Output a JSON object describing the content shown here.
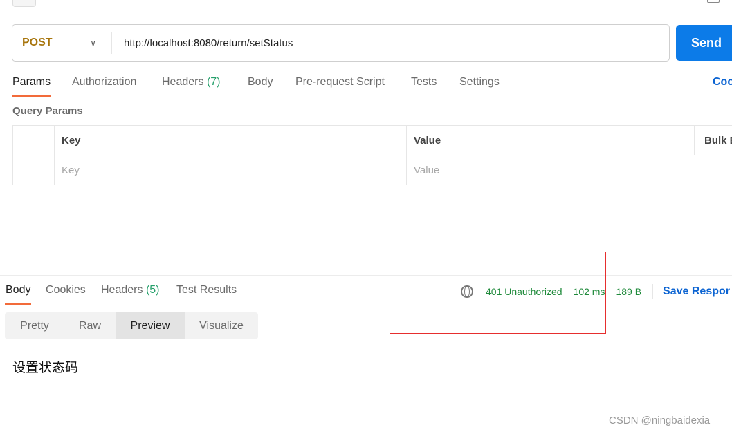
{
  "request": {
    "method": "POST",
    "url": "http://localhost:8080/return/setStatus",
    "send_label": "Send"
  },
  "tabs": [
    {
      "label": "Params"
    },
    {
      "label": "Authorization"
    },
    {
      "label": "Headers",
      "count": "(7)"
    },
    {
      "label": "Body"
    },
    {
      "label": "Pre-request Script"
    },
    {
      "label": "Tests"
    },
    {
      "label": "Settings"
    }
  ],
  "code_label": "Coo",
  "query_params": {
    "title": "Query Params",
    "headers": [
      "Key",
      "Value",
      "Bulk E"
    ],
    "placeholders": [
      "Key",
      "Value"
    ]
  },
  "response": {
    "tabs": [
      {
        "label": "Body"
      },
      {
        "label": "Cookies"
      },
      {
        "label": "Headers",
        "count": "(5)"
      },
      {
        "label": "Test Results"
      }
    ],
    "status": "401 Unauthorized",
    "time": "102 ms",
    "size": "189 B",
    "save_label": "Save Respor",
    "formats": [
      "Pretty",
      "Raw",
      "Preview",
      "Visualize"
    ],
    "body": "设置状态码"
  },
  "watermark": "CSDN @ningbaidexia",
  "colors": {
    "accent": "#f26b3a",
    "send": "#0c7be8",
    "status": "#1f8a3b",
    "method": "#a8760e",
    "highlight_box": "#e62e2e"
  }
}
